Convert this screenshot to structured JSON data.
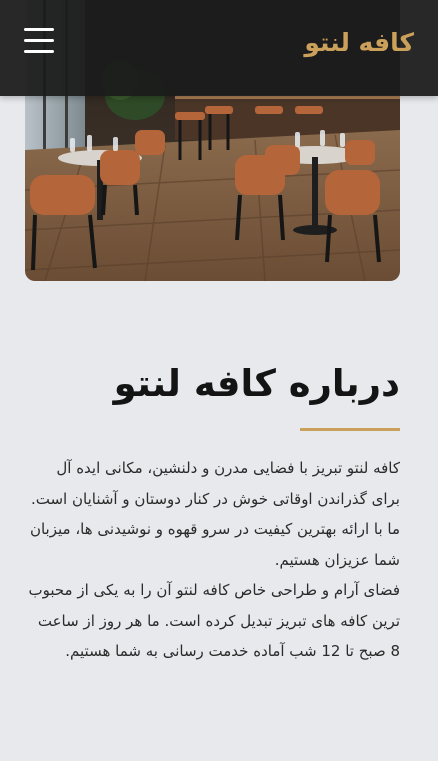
{
  "header": {
    "brand": "کافه لنتو",
    "menu_icon": "hamburger-menu-icon",
    "background": "#1c1c1c",
    "brand_color": "#caa05a"
  },
  "hero": {
    "image": "cafe-interior-photo"
  },
  "about": {
    "title": "درباره کافه لنتو",
    "accent_color": "#caa05a",
    "paragraph_1": "کافه لنتو تبریز با فضایی مدرن و دلنشین، مکانی ایده آل برای گذراندن اوقاتی خوش در کنار دوستان و آشنایان است. ما با ارائه بهترین کیفیت در سرو قهوه و نوشیدنی ها، میزبان شما عزیزان هستیم.",
    "paragraph_2": "فضای آرام و طراحی خاص کافه لنتو آن را به یکی از محبوب ترین کافه های تبریز تبدیل کرده است. ما هر روز از ساعت 8 صبح تا 12 شب آماده خدمت رسانی به شما هستیم."
  }
}
